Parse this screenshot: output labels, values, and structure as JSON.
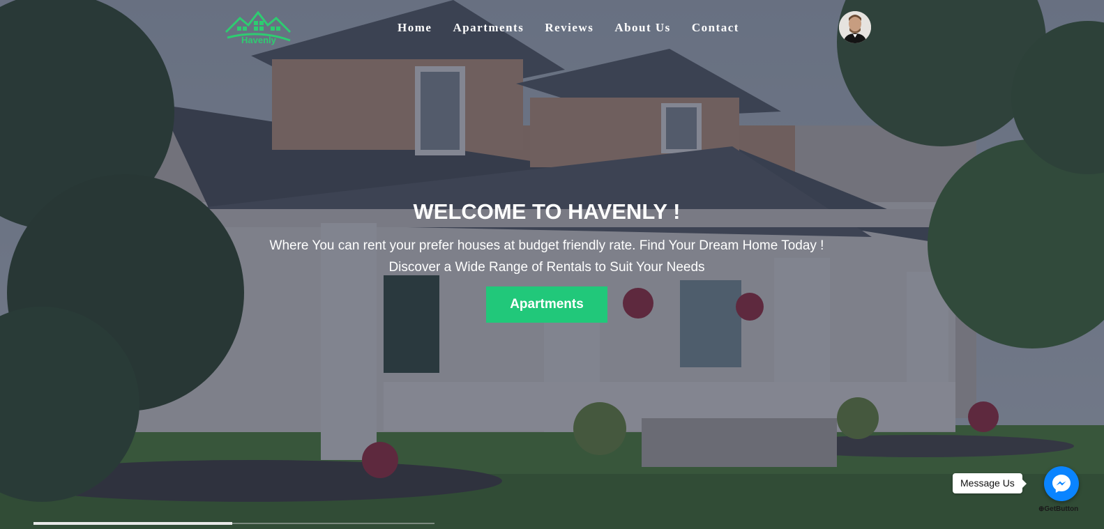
{
  "brand": {
    "name": "Havenly",
    "color": "#2ecc71"
  },
  "nav": {
    "items": [
      {
        "label": "Home"
      },
      {
        "label": "Apartments"
      },
      {
        "label": "Reviews"
      },
      {
        "label": "About Us"
      },
      {
        "label": "Contact"
      }
    ]
  },
  "user": {
    "avatar_icon": "user-avatar"
  },
  "hero": {
    "title": "WELCOME TO HAVENLY !",
    "line1": "Where You can rent your prefer houses at budget friendly rate. Find Your Dream Home Today !",
    "line2": "Discover a Wide Range of Rentals to Suit Your Needs",
    "cta_label": "Apartments",
    "cta_color": "#21c87a"
  },
  "messenger": {
    "bubble_text": "Message Us",
    "icon": "messenger-icon",
    "powered_by": "GetButton"
  }
}
